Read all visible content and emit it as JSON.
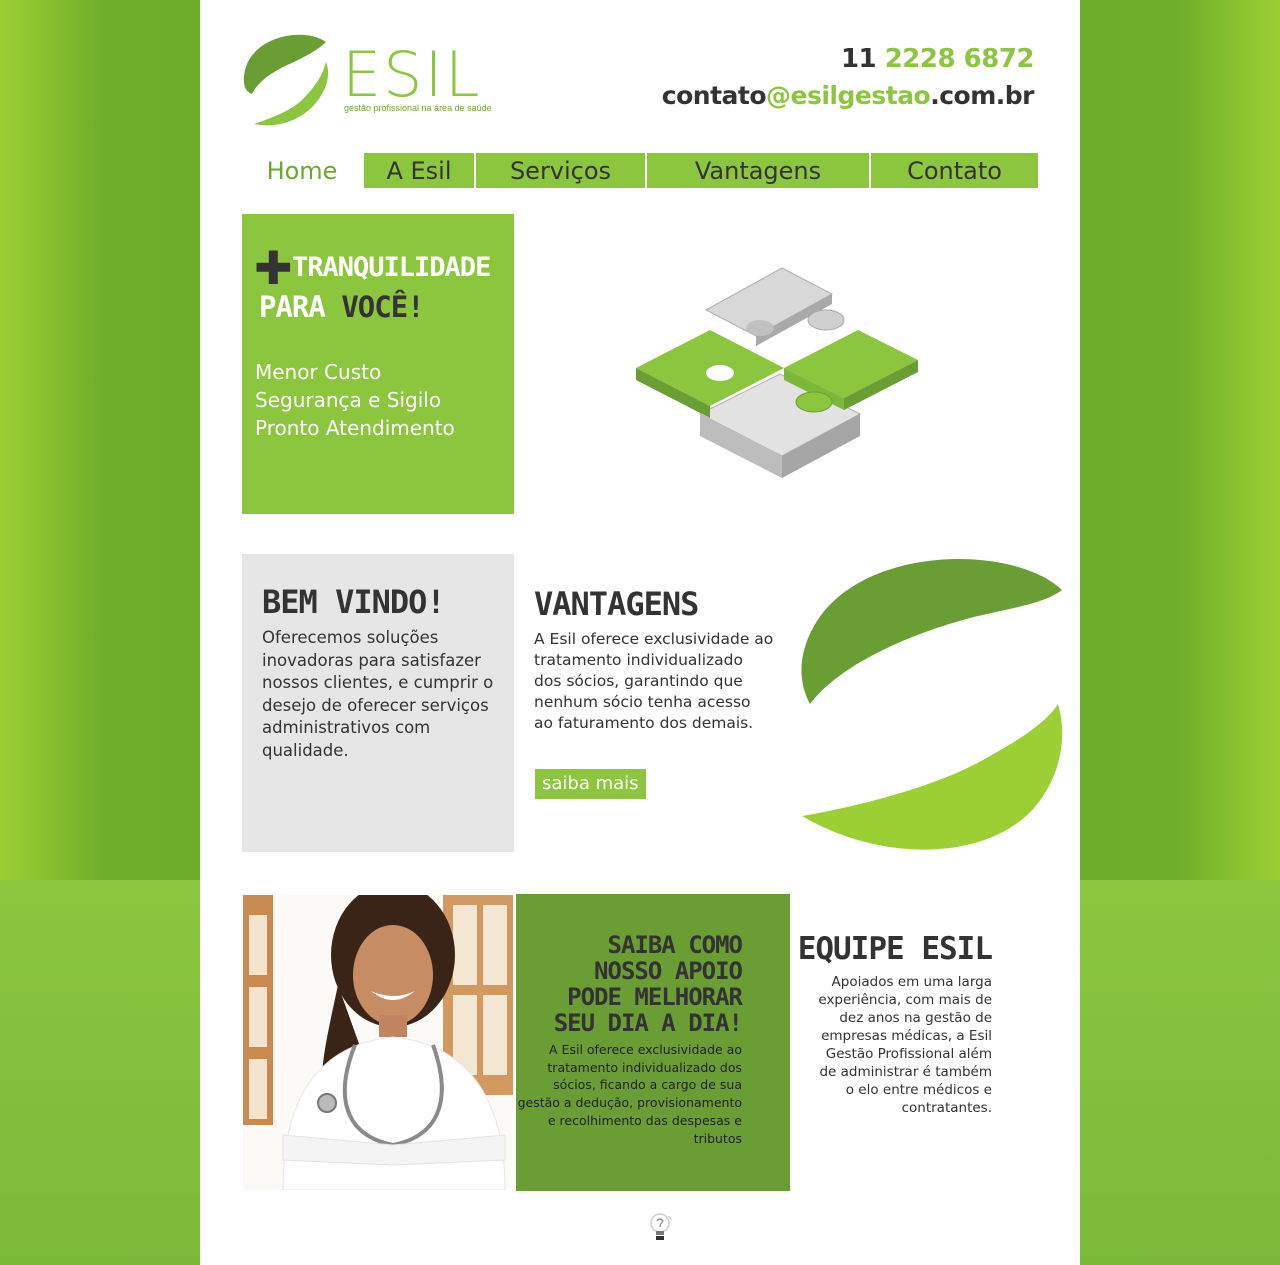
{
  "brand": {
    "name": "ESIL",
    "tagline": "gestão profissional na área de saúde",
    "green": "#8cc63f",
    "dark_green": "#6a9e35",
    "text_dark": "#333333"
  },
  "contact": {
    "phone_ddd": "11",
    "phone_number": "2228 6872",
    "email_user": "contato",
    "email_domain": "@esilgestao",
    "email_tld": ".com.br"
  },
  "nav": {
    "items": [
      {
        "label": "Home",
        "active": true
      },
      {
        "label": "A Esil"
      },
      {
        "label": "Serviços"
      },
      {
        "label": "Vantagens"
      },
      {
        "label": "Contato"
      }
    ]
  },
  "hero": {
    "plus": "✚",
    "line1": "TRANQUILIDADE",
    "line2_a": "PARA ",
    "line2_b": "VOCÊ!",
    "benefits": [
      "Menor Custo",
      "Segurança e Sigilo",
      "Pronto Atendimento"
    ],
    "image": "puzzle-pieces-image"
  },
  "welcome": {
    "title": "BEM VINDO!",
    "text": "Oferecemos soluções inovadoras para satisfazer nossos clientes, e cumprir o desejo de oferecer serviços administrativos com qualidade."
  },
  "vantagens": {
    "title": "VANTAGENS",
    "text": "A Esil oferece exclusividade ao tratamento individualizado dos sócios, garantindo que nenhum sócio tenha acesso ao faturamento dos demais.",
    "button": "saiba mais"
  },
  "apoio": {
    "title_lines": [
      "SAIBA COMO",
      "NOSSO APOIO",
      "PODE MELHORAR",
      "SEU DIA A DIA!"
    ],
    "text": "A Esil oferece exclusividade ao tratamento individualizado dos sócios, ficando a cargo de sua gestão a dedução, provisionamento e recolhimento das despesas e tributos"
  },
  "equipe": {
    "title": "EQUIPE ESIL",
    "text": "Apoiados em uma larga experiência, com mais de dez anos na gestão de empresas médicas, a Esil Gestão Profissional além de administrar é também o elo entre médicos e contratantes."
  },
  "photo": "doctor-photo",
  "footer_icon": "lightbulb-icon"
}
